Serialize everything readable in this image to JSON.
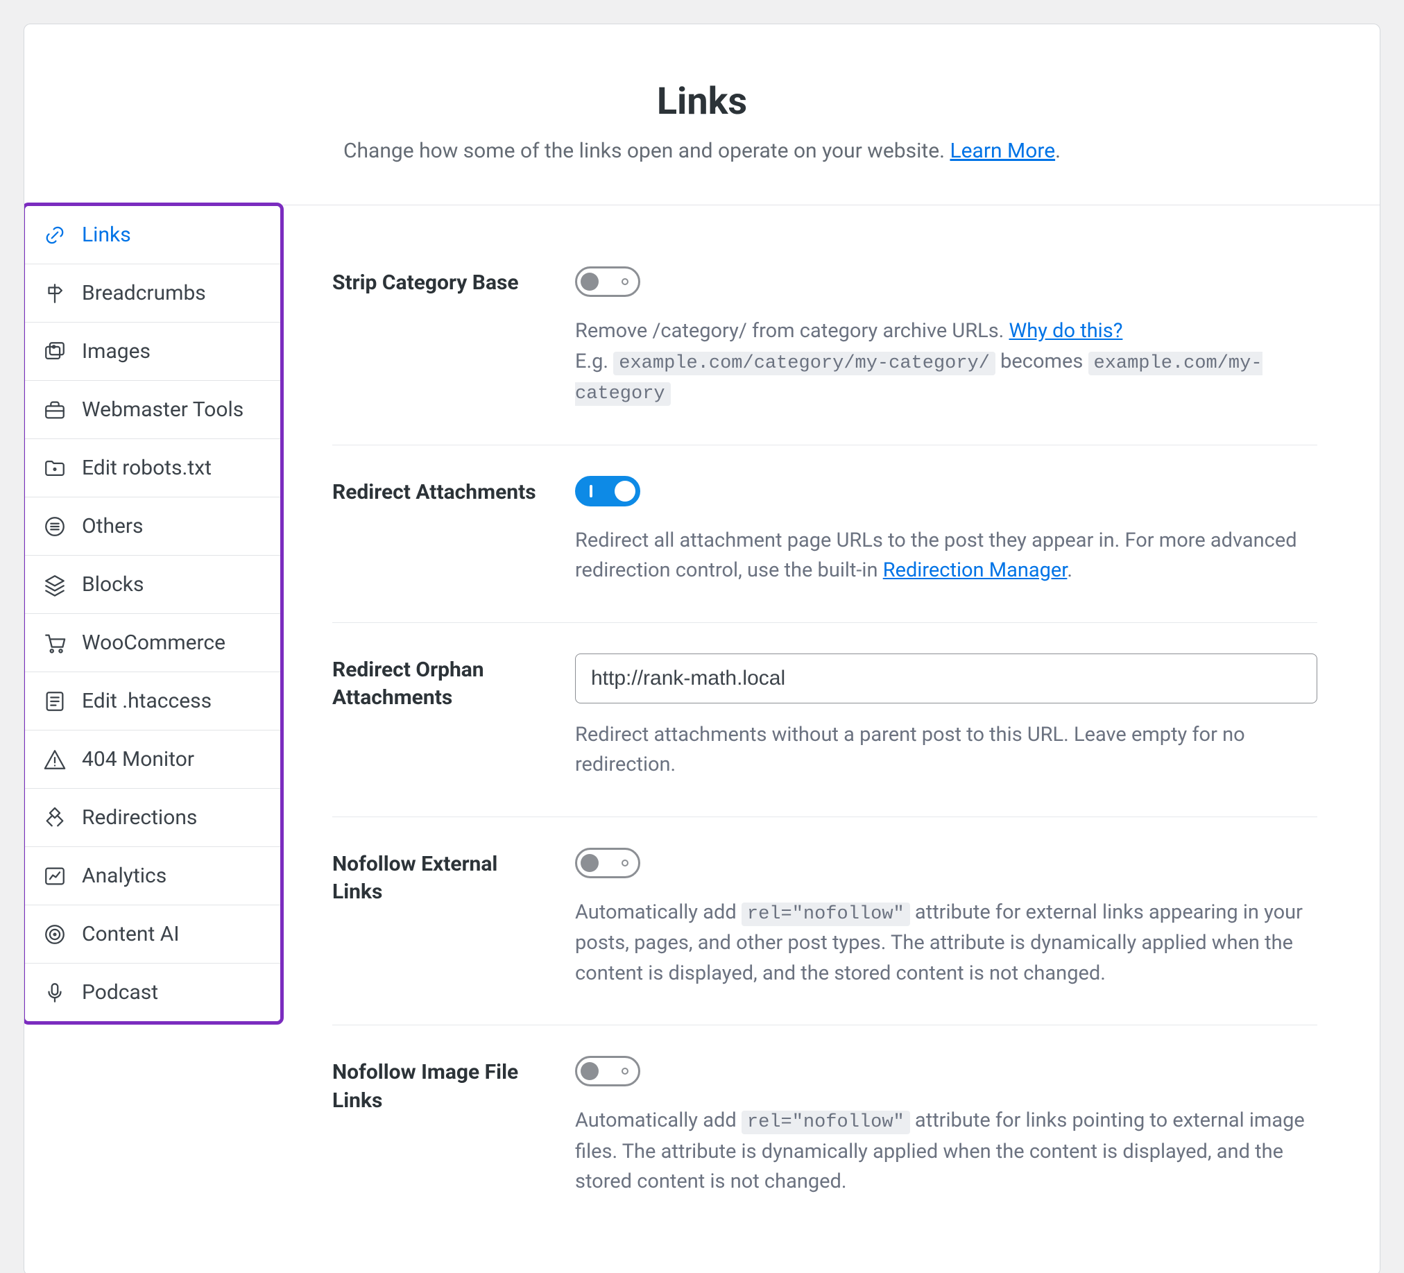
{
  "header": {
    "title": "Links",
    "subtitle_pre": "Change how some of the links open and operate on your website. ",
    "learn_more": "Learn More",
    "subtitle_post": "."
  },
  "sidebar": {
    "items": [
      {
        "id": "links",
        "label": "Links",
        "active": true
      },
      {
        "id": "breadcrumbs",
        "label": "Breadcrumbs"
      },
      {
        "id": "images",
        "label": "Images"
      },
      {
        "id": "webmaster-tools",
        "label": "Webmaster Tools"
      },
      {
        "id": "edit-robots",
        "label": "Edit robots.txt"
      },
      {
        "id": "others",
        "label": "Others"
      },
      {
        "id": "blocks",
        "label": "Blocks"
      },
      {
        "id": "woocommerce",
        "label": "WooCommerce"
      },
      {
        "id": "edit-htaccess",
        "label": "Edit .htaccess"
      },
      {
        "id": "404-monitor",
        "label": "404 Monitor"
      },
      {
        "id": "redirections",
        "label": "Redirections"
      },
      {
        "id": "analytics",
        "label": "Analytics"
      },
      {
        "id": "content-ai",
        "label": "Content AI"
      },
      {
        "id": "podcast",
        "label": "Podcast"
      }
    ]
  },
  "settings": {
    "strip_category_base": {
      "label": "Strip Category Base",
      "state": "off",
      "desc_pre": "Remove /category/ from category archive URLs. ",
      "why_link": "Why do this?",
      "eg_label": "E.g. ",
      "code1": "example.com/category/my-category/",
      "becomes": " becomes ",
      "code2": "example.com/my-category"
    },
    "redirect_attachments": {
      "label": "Redirect Attachments",
      "state": "on",
      "desc_pre": "Redirect all attachment page URLs to the post they appear in. For more advanced redirection control, use the built-in ",
      "mgr_link": "Redirection Manager",
      "desc_post": "."
    },
    "redirect_orphan": {
      "label": "Redirect Orphan Attachments",
      "value": "http://rank-math.local",
      "desc": "Redirect attachments without a parent post to this URL. Leave empty for no redirection."
    },
    "nofollow_external": {
      "label": "Nofollow External Links",
      "state": "off",
      "desc_pre": "Automatically add ",
      "code": "rel=\"nofollow\"",
      "desc_post": " attribute for external links appearing in your posts, pages, and other post types. The attribute is dynamically applied when the content is displayed, and the stored content is not changed."
    },
    "nofollow_image": {
      "label": "Nofollow Image File Links",
      "state": "off",
      "desc_pre": "Automatically add ",
      "code": "rel=\"nofollow\"",
      "desc_post": " attribute for links pointing to external image files. The attribute is dynamically applied when the content is displayed, and the stored content is not changed."
    }
  }
}
